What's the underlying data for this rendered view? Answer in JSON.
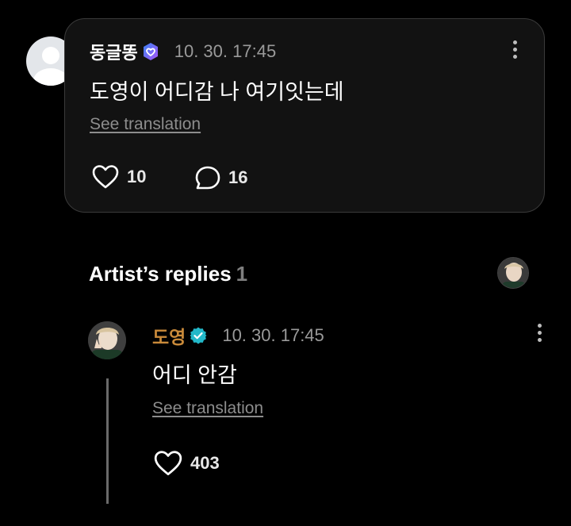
{
  "post": {
    "username": "동글똥",
    "timestamp": "10. 30. 17:45",
    "text": "도영이 어디감 나 여기잇는데",
    "translate_label": "See translation",
    "likes": "10",
    "comments": "16"
  },
  "replies_section": {
    "title": "Artist’s replies",
    "count": "1"
  },
  "reply": {
    "username": "도영",
    "timestamp": "10. 30. 17:45",
    "text": "어디 안감",
    "translate_label": "See translation",
    "likes": "403"
  },
  "icons": {
    "post_badge": "heart-membership-badge-icon",
    "reply_badge": "verified-badge-icon",
    "like": "heart-outline-icon",
    "comment": "speech-bubble-icon",
    "more": "more-vertical-icon"
  },
  "colors": {
    "background": "#000000",
    "card": "#121212",
    "artist_name": "#c98a3a",
    "verified": "#22b8c9",
    "badge_gradient_start": "#3b82f6",
    "badge_gradient_end": "#a855f7"
  }
}
